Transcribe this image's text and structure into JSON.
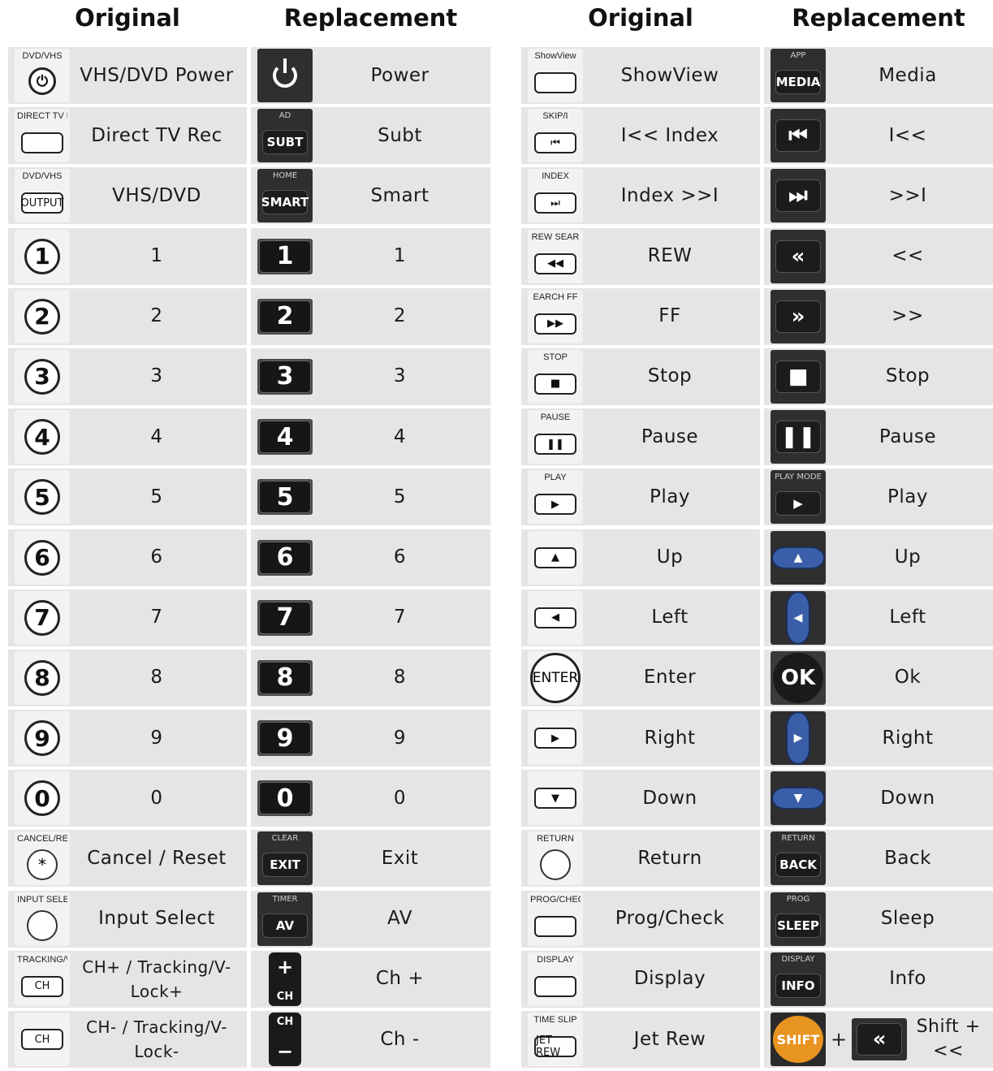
{
  "headers": {
    "left_original": "Original",
    "left_replacement": "Replacement",
    "right_original": "Original",
    "right_replacement": "Replacement"
  },
  "left_rows": [
    {
      "orig_label": "VHS/DVD Power",
      "orig_icon": "dvd-vhs-power-icon",
      "orig_text": "DVD/VHS",
      "repl_label": "Power",
      "repl_icon": "power-icon",
      "repl_text": ""
    },
    {
      "orig_label": "Direct TV Rec",
      "orig_icon": "direct-tv-rec-icon",
      "orig_text": "DIRECT TV REC",
      "repl_label": "Subt",
      "repl_icon": "subt-key-icon",
      "repl_text": "AD",
      "repl_key": "SUBT"
    },
    {
      "orig_label": "VHS/DVD",
      "orig_icon": "output-button-icon",
      "orig_text": "DVD/VHS",
      "orig_key": "OUTPUT",
      "repl_label": "Smart",
      "repl_icon": "smart-key-icon",
      "repl_text": "HOME",
      "repl_key": "SMART"
    },
    {
      "orig_label": "1",
      "orig_key": "1",
      "repl_label": "1",
      "repl_key": "1"
    },
    {
      "orig_label": "2",
      "orig_key": "2",
      "repl_label": "2",
      "repl_key": "2"
    },
    {
      "orig_label": "3",
      "orig_key": "3",
      "repl_label": "3",
      "repl_key": "3"
    },
    {
      "orig_label": "4",
      "orig_key": "4",
      "repl_label": "4",
      "repl_key": "4"
    },
    {
      "orig_label": "5",
      "orig_key": "5",
      "repl_label": "5",
      "repl_key": "5"
    },
    {
      "orig_label": "6",
      "orig_key": "6",
      "repl_label": "6",
      "repl_key": "6"
    },
    {
      "orig_label": "7",
      "orig_key": "7",
      "repl_label": "7",
      "repl_key": "7"
    },
    {
      "orig_label": "8",
      "orig_key": "8",
      "repl_label": "8",
      "repl_key": "8"
    },
    {
      "orig_label": "9",
      "orig_key": "9",
      "repl_label": "9",
      "repl_key": "9"
    },
    {
      "orig_label": "0",
      "orig_key": "0",
      "repl_label": "0",
      "repl_key": "0"
    },
    {
      "orig_label": "Cancel / Reset",
      "orig_icon": "cancel-reset-icon",
      "orig_text": "CANCEL/RESET",
      "orig_key": "*",
      "repl_label": "Exit",
      "repl_icon": "exit-key-icon",
      "repl_text": "CLEAR",
      "repl_key": "EXIT"
    },
    {
      "orig_label": "Input Select",
      "orig_icon": "input-select-icon",
      "orig_text": "INPUT SELECT",
      "repl_label": "AV",
      "repl_icon": "av-key-icon",
      "repl_text": "TIMER",
      "repl_key": "AV"
    },
    {
      "orig_label": "CH+ / Tracking/V-Lock+",
      "orig_icon": "ch-up-icon",
      "orig_text": "TRACKING/V-LOCK",
      "orig_key": "CH",
      "repl_label": "Ch +",
      "repl_icon": "ch-plus-key-icon",
      "repl_key": "+",
      "repl_sub": "CH"
    },
    {
      "orig_label": "CH- / Tracking/V-Lock-",
      "orig_icon": "ch-down-icon",
      "orig_key": "CH",
      "repl_label": "Ch -",
      "repl_icon": "ch-minus-key-icon",
      "repl_key": "−",
      "repl_sub": "CH"
    }
  ],
  "right_rows": [
    {
      "orig_label": "ShowView",
      "orig_icon": "showview-icon",
      "orig_text": "ShowView",
      "repl_label": "Media",
      "repl_icon": "media-key-icon",
      "repl_text": "APP",
      "repl_key": "MEDIA"
    },
    {
      "orig_label": "I<< Index",
      "orig_icon": "skip-back-icon",
      "orig_text": "SKIP/I",
      "orig_key": "⏮",
      "repl_label": "I<<",
      "repl_icon": "skip-back-key-icon",
      "repl_key": "⏮"
    },
    {
      "orig_label": "Index >>I",
      "orig_icon": "skip-forward-icon",
      "orig_text": "INDEX",
      "orig_key": "⏭",
      "repl_label": ">>I",
      "repl_icon": "skip-forward-key-icon",
      "repl_key": "⏭"
    },
    {
      "orig_label": "REW",
      "orig_icon": "rewind-icon",
      "orig_text": "REW SEAR",
      "orig_key": "◀◀",
      "repl_label": "<<",
      "repl_icon": "rewind-key-icon",
      "repl_key": "«"
    },
    {
      "orig_label": "FF",
      "orig_icon": "fast-forward-icon",
      "orig_text": "EARCH FF",
      "orig_key": "▶▶",
      "repl_label": ">>",
      "repl_icon": "fast-forward-key-icon",
      "repl_key": "»"
    },
    {
      "orig_label": "Stop",
      "orig_icon": "stop-icon",
      "orig_text": "STOP",
      "orig_key": "■",
      "repl_label": "Stop",
      "repl_icon": "stop-key-icon",
      "repl_key": "■"
    },
    {
      "orig_label": "Pause",
      "orig_icon": "pause-icon",
      "orig_text": "PAUSE",
      "orig_key": "❚❚",
      "repl_label": "Pause",
      "repl_icon": "pause-key-icon",
      "repl_key": "❚❚"
    },
    {
      "orig_label": "Play",
      "orig_icon": "play-icon",
      "orig_text": "PLAY",
      "orig_key": "▶",
      "repl_label": "Play",
      "repl_icon": "play-key-icon",
      "repl_text": "PLAY MODE",
      "repl_key": "▶"
    },
    {
      "orig_label": "Up",
      "orig_icon": "up-arrow-icon",
      "orig_key": "▲",
      "repl_label": "Up",
      "repl_icon": "blue-up-icon",
      "repl_key": "▲"
    },
    {
      "orig_label": "Left",
      "orig_icon": "left-arrow-icon",
      "orig_key": "◀",
      "repl_label": "Left",
      "repl_icon": "blue-left-icon",
      "repl_key": "◀"
    },
    {
      "orig_label": "Enter",
      "orig_icon": "enter-icon",
      "orig_key": "ENTER",
      "repl_label": "Ok",
      "repl_icon": "ok-key-icon",
      "repl_key": "OK"
    },
    {
      "orig_label": "Right",
      "orig_icon": "right-arrow-icon",
      "orig_key": "▶",
      "repl_label": "Right",
      "repl_icon": "blue-right-icon",
      "repl_key": "▶"
    },
    {
      "orig_label": "Down",
      "orig_icon": "down-arrow-icon",
      "orig_key": "▼",
      "repl_label": "Down",
      "repl_icon": "blue-down-icon",
      "repl_key": "▼"
    },
    {
      "orig_label": "Return",
      "orig_icon": "return-icon",
      "orig_text": "RETURN",
      "repl_label": "Back",
      "repl_icon": "back-key-icon",
      "repl_text": "RETURN",
      "repl_key": "BACK"
    },
    {
      "orig_label": "Prog/Check",
      "orig_icon": "prog-check-icon",
      "orig_text": "PROG/CHECK",
      "repl_label": "Sleep",
      "repl_icon": "sleep-key-icon",
      "repl_text": "PROG",
      "repl_key": "SLEEP"
    },
    {
      "orig_label": "Display",
      "orig_icon": "display-icon",
      "orig_text": "DISPLAY",
      "repl_label": "Info",
      "repl_icon": "info-key-icon",
      "repl_text": "DISPLAY",
      "repl_key": "INFO"
    },
    {
      "orig_label": "Jet Rew",
      "orig_icon": "jet-rew-icon",
      "orig_text": "TIME SLIP",
      "orig_key": "JET REW",
      "repl_label": "Shift + <<",
      "repl_icon": "shift-key-icon",
      "repl_key": "SHIFT",
      "repl_plus": "+",
      "repl_key2": "«"
    }
  ]
}
